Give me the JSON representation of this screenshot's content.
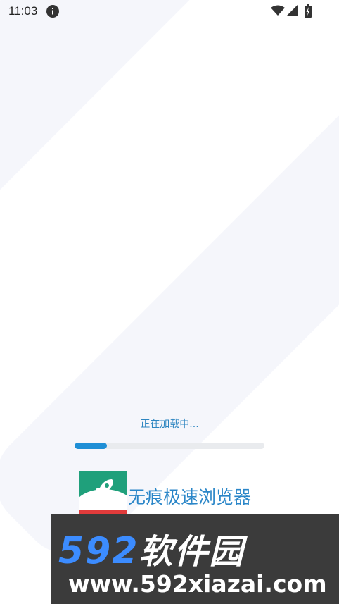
{
  "status_bar": {
    "time": "11:03",
    "icons": [
      "info-icon",
      "wifi-icon",
      "signal-icon",
      "battery-charging-icon"
    ]
  },
  "loading": {
    "text": "正在加载中...",
    "progress": 0.17,
    "colors": {
      "fill": "#1f8fd6",
      "track": "#e9ebee"
    }
  },
  "app": {
    "name": "无痕极速浏览器",
    "logo_icon": "rocket-icon"
  },
  "watermark": {
    "brand_number": "592",
    "brand_text": "软件园",
    "url": "www.592xiazai.com"
  }
}
